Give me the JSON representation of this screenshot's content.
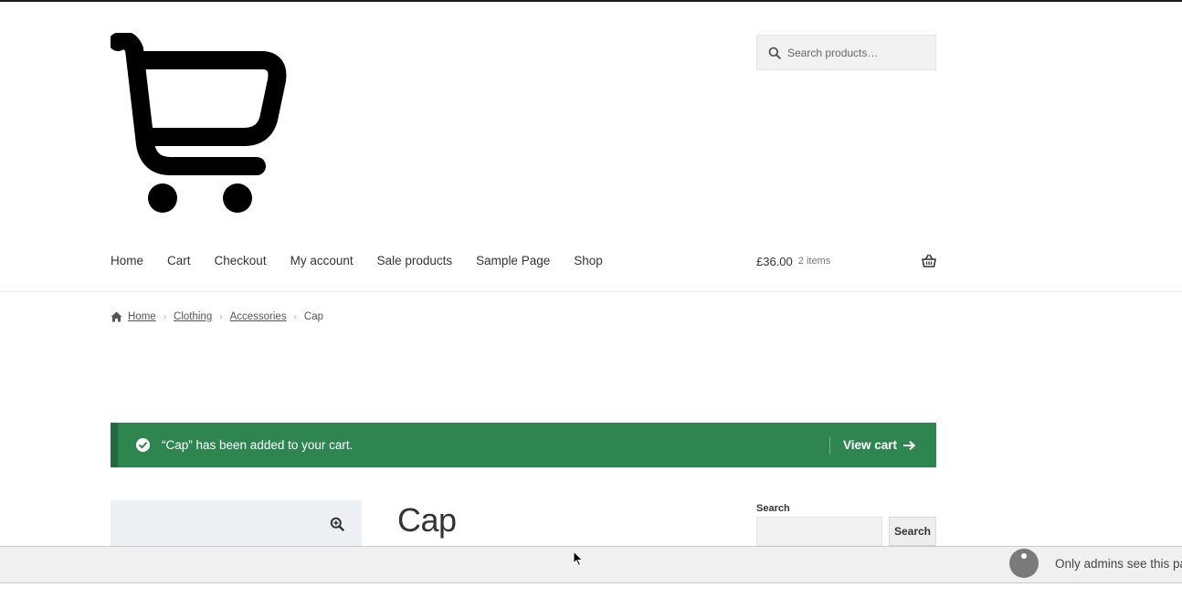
{
  "header": {
    "logo_icon": "shopping-cart-icon",
    "search": {
      "placeholder": "Search products…"
    }
  },
  "nav": {
    "items": [
      "Home",
      "Cart",
      "Checkout",
      "My account",
      "Sale products",
      "Sample Page",
      "Shop"
    ]
  },
  "mini_cart": {
    "amount": "£36.00",
    "count": "2 items"
  },
  "breadcrumb": {
    "items": [
      "Home",
      "Clothing",
      "Accessories"
    ],
    "current": "Cap"
  },
  "notice": {
    "message": "“Cap” has been added to your cart.",
    "view_cart_label": "View cart",
    "color": "#2e8550"
  },
  "product": {
    "title": "Cap"
  },
  "sidebar": {
    "search_label": "Search",
    "search_button": "Search"
  },
  "admin_bar": {
    "text": "Only admins see this panel"
  }
}
